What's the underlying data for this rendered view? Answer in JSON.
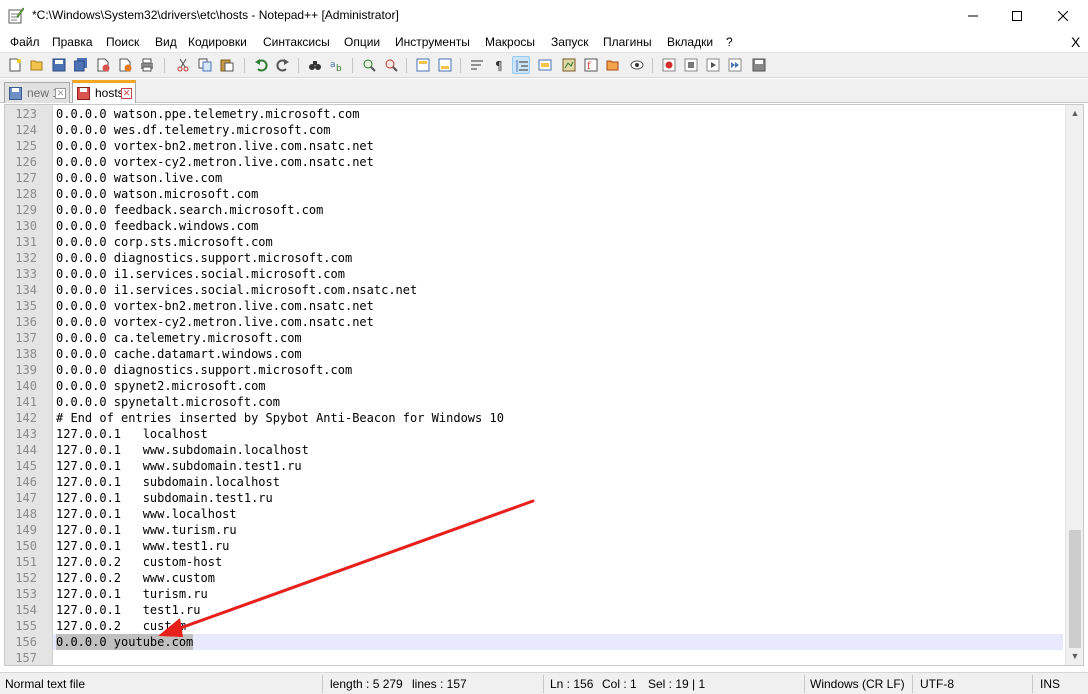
{
  "window": {
    "title": "*C:\\Windows\\System32\\drivers\\etc\\hosts - Notepad++ [Administrator]"
  },
  "menu": [
    "Файл",
    "Правка",
    "Поиск",
    "Вид",
    "Кодировки",
    "Синтаксисы",
    "Опции",
    "Инструменты",
    "Макросы",
    "Запуск",
    "Плагины",
    "Вкладки",
    "?"
  ],
  "menu_close": "X",
  "tabs": [
    {
      "label": "new 1",
      "active": false
    },
    {
      "label": "hosts",
      "active": true
    }
  ],
  "editor": {
    "lines": [
      {
        "num": "123",
        "text": "0.0.0.0 watson.ppe.telemetry.microsoft.com"
      },
      {
        "num": "124",
        "text": "0.0.0.0 wes.df.telemetry.microsoft.com"
      },
      {
        "num": "125",
        "text": "0.0.0.0 vortex-bn2.metron.live.com.nsatc.net"
      },
      {
        "num": "126",
        "text": "0.0.0.0 vortex-cy2.metron.live.com.nsatc.net"
      },
      {
        "num": "127",
        "text": "0.0.0.0 watson.live.com"
      },
      {
        "num": "128",
        "text": "0.0.0.0 watson.microsoft.com"
      },
      {
        "num": "129",
        "text": "0.0.0.0 feedback.search.microsoft.com"
      },
      {
        "num": "130",
        "text": "0.0.0.0 feedback.windows.com"
      },
      {
        "num": "131",
        "text": "0.0.0.0 corp.sts.microsoft.com"
      },
      {
        "num": "132",
        "text": "0.0.0.0 diagnostics.support.microsoft.com"
      },
      {
        "num": "133",
        "text": "0.0.0.0 i1.services.social.microsoft.com"
      },
      {
        "num": "134",
        "text": "0.0.0.0 i1.services.social.microsoft.com.nsatc.net"
      },
      {
        "num": "135",
        "text": "0.0.0.0 vortex-bn2.metron.live.com.nsatc.net"
      },
      {
        "num": "136",
        "text": "0.0.0.0 vortex-cy2.metron.live.com.nsatc.net"
      },
      {
        "num": "137",
        "text": "0.0.0.0 ca.telemetry.microsoft.com"
      },
      {
        "num": "138",
        "text": "0.0.0.0 cache.datamart.windows.com"
      },
      {
        "num": "139",
        "text": "0.0.0.0 diagnostics.support.microsoft.com"
      },
      {
        "num": "140",
        "text": "0.0.0.0 spynet2.microsoft.com"
      },
      {
        "num": "141",
        "text": "0.0.0.0 spynetalt.microsoft.com"
      },
      {
        "num": "142",
        "text": "# End of entries inserted by Spybot Anti-Beacon for Windows 10"
      },
      {
        "num": "143",
        "text": "127.0.0.1   localhost"
      },
      {
        "num": "144",
        "text": "127.0.0.1   www.subdomain.localhost"
      },
      {
        "num": "145",
        "text": "127.0.0.1   www.subdomain.test1.ru"
      },
      {
        "num": "146",
        "text": "127.0.0.1   subdomain.localhost"
      },
      {
        "num": "147",
        "text": "127.0.0.1   subdomain.test1.ru"
      },
      {
        "num": "148",
        "text": "127.0.0.1   www.localhost"
      },
      {
        "num": "149",
        "text": "127.0.0.1   www.turism.ru"
      },
      {
        "num": "150",
        "text": "127.0.0.1   www.test1.ru"
      },
      {
        "num": "151",
        "text": "127.0.0.2   custom-host"
      },
      {
        "num": "152",
        "text": "127.0.0.2   www.custom"
      },
      {
        "num": "153",
        "text": "127.0.0.1   turism.ru"
      },
      {
        "num": "154",
        "text": "127.0.0.1   test1.ru"
      },
      {
        "num": "155",
        "text": "127.0.0.2   custom"
      },
      {
        "num": "156",
        "text": "0.0.0.0 youtube.com",
        "current": true,
        "selected": true
      },
      {
        "num": "157",
        "text": ""
      }
    ]
  },
  "status": {
    "file_type": "Normal text file",
    "length": "length : 5 279",
    "lines": "lines : 157",
    "ln": "Ln : 156",
    "col": "Col : 1",
    "sel": "Sel : 19 | 1",
    "eol": "Windows (CR LF)",
    "encoding": "UTF-8",
    "mode": "INS"
  },
  "colors": {
    "annotation_arrow": "#e8201c",
    "current_line": "#e8e8ff",
    "selection": "#c0c0c0",
    "tab_active_accent": "#f5a623"
  }
}
